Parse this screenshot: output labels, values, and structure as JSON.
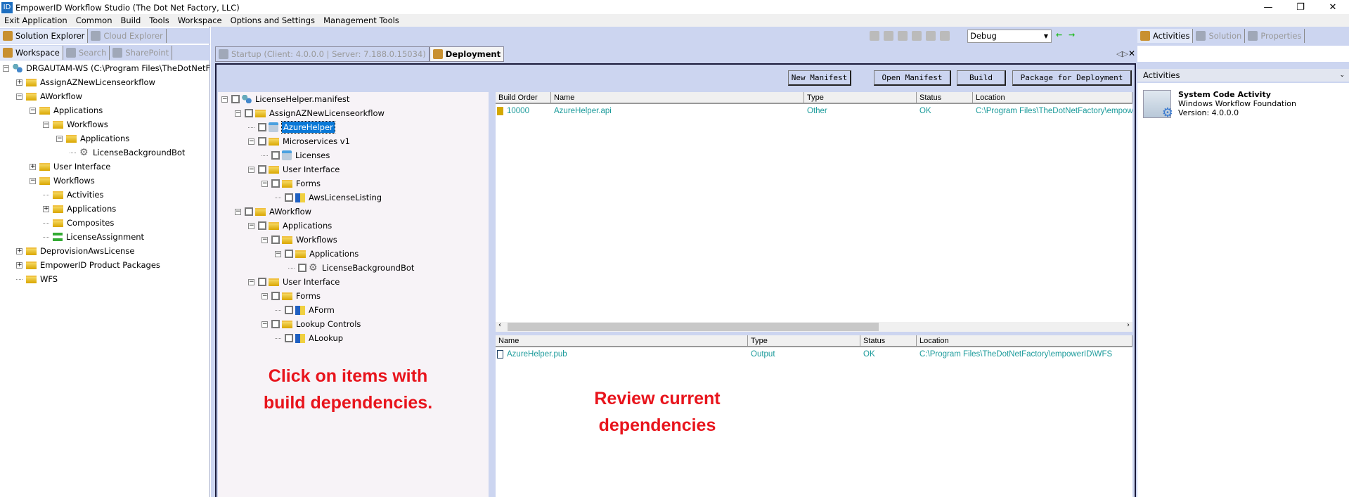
{
  "window": {
    "title": "EmpowerID Workflow Studio (The Dot Net Factory, LLC)",
    "logo": "ID",
    "controls": [
      "minimize",
      "restore",
      "close"
    ]
  },
  "menu": [
    "Exit Application",
    "Common",
    "Build",
    "Tools",
    "Workspace",
    "Options and Settings",
    "Management Tools"
  ],
  "left": {
    "top_tabs": [
      {
        "label": "Solution Explorer",
        "active": true
      },
      {
        "label": "Cloud Explorer",
        "active": false
      }
    ],
    "sub_tabs": [
      {
        "label": "Workspace",
        "active": true
      },
      {
        "label": "Search",
        "active": false
      },
      {
        "label": "SharePoint",
        "active": false
      }
    ],
    "tree": [
      {
        "label": "DRGAUTAM-WS (C:\\Program Files\\TheDotNetFactory\\empowerID\\WFS)",
        "level": 0,
        "exp": "minus",
        "icon": "network"
      },
      {
        "label": "AssignAZNewLicenseorkflow",
        "level": 1,
        "exp": "plus",
        "icon": "folder"
      },
      {
        "label": "AWorkflow",
        "level": 1,
        "exp": "minus",
        "icon": "folder"
      },
      {
        "label": "Applications",
        "level": 2,
        "exp": "minus",
        "icon": "folder"
      },
      {
        "label": "Workflows",
        "level": 3,
        "exp": "minus",
        "icon": "folder"
      },
      {
        "label": "Applications",
        "level": 4,
        "exp": "minus",
        "icon": "folder"
      },
      {
        "label": "LicenseBackgroundBot",
        "level": 5,
        "exp": null,
        "icon": "gear"
      },
      {
        "label": "User Interface",
        "level": 2,
        "exp": "plus",
        "icon": "folder"
      },
      {
        "label": "Workflows",
        "level": 2,
        "exp": "minus",
        "icon": "folder"
      },
      {
        "label": "Activities",
        "level": 3,
        "exp": null,
        "icon": "folder"
      },
      {
        "label": "Applications",
        "level": 3,
        "exp": "plus",
        "icon": "folder"
      },
      {
        "label": "Composites",
        "level": 3,
        "exp": null,
        "icon": "folder"
      },
      {
        "label": "LicenseAssignment",
        "level": 3,
        "exp": null,
        "icon": "workflow"
      },
      {
        "label": "DeprovisionAwsLicense",
        "level": 1,
        "exp": "plus",
        "icon": "folder"
      },
      {
        "label": "EmpowerID Product Packages",
        "level": 1,
        "exp": "plus",
        "icon": "folder"
      },
      {
        "label": "WFS",
        "level": 1,
        "exp": null,
        "icon": "folder"
      }
    ]
  },
  "toolbar": {
    "icons": [
      "save-icon",
      "check-icon",
      "play-icon",
      "stop-icon",
      "copy-icon",
      "windows-icon"
    ],
    "config": "Debug",
    "nav": [
      "back-arrow-icon",
      "forward-arrow-icon"
    ]
  },
  "doc_tabs": [
    {
      "label": "Startup (Client: 4.0.0.0 | Server: 7.188.0.15034)",
      "active": false
    },
    {
      "label": "Deployment",
      "active": true
    }
  ],
  "deployment": {
    "buttons": [
      "New Manifest",
      "Open Manifest",
      "Build",
      "Package for Deployment"
    ],
    "manifest_tree": [
      {
        "label": "LicenseHelper.manifest",
        "level": 0,
        "exp": "minus",
        "icon": "network"
      },
      {
        "label": "AssignAZNewLicenseorkflow",
        "level": 1,
        "exp": "minus",
        "icon": "folder"
      },
      {
        "label": "AzureHelper",
        "level": 2,
        "exp": null,
        "icon": "service",
        "selected": true
      },
      {
        "label": "Microservices v1",
        "level": 2,
        "exp": "minus",
        "icon": "folder"
      },
      {
        "label": "Licenses",
        "level": 3,
        "exp": null,
        "icon": "service"
      },
      {
        "label": "User Interface",
        "level": 2,
        "exp": "minus",
        "icon": "folder"
      },
      {
        "label": "Forms",
        "level": 3,
        "exp": "minus",
        "icon": "folder"
      },
      {
        "label": "AwsLicenseListing",
        "level": 4,
        "exp": null,
        "icon": "form"
      },
      {
        "label": "AWorkflow",
        "level": 1,
        "exp": "minus",
        "icon": "folder"
      },
      {
        "label": "Applications",
        "level": 2,
        "exp": "minus",
        "icon": "folder"
      },
      {
        "label": "Workflows",
        "level": 3,
        "exp": "minus",
        "icon": "folder"
      },
      {
        "label": "Applications",
        "level": 4,
        "exp": "minus",
        "icon": "folder"
      },
      {
        "label": "LicenseBackgroundBot",
        "level": 5,
        "exp": null,
        "icon": "gear"
      },
      {
        "label": "User Interface",
        "level": 2,
        "exp": "minus",
        "icon": "folder"
      },
      {
        "label": "Forms",
        "level": 3,
        "exp": "minus",
        "icon": "folder"
      },
      {
        "label": "AForm",
        "level": 4,
        "exp": null,
        "icon": "form"
      },
      {
        "label": "Lookup Controls",
        "level": 3,
        "exp": "minus",
        "icon": "folder"
      },
      {
        "label": "ALookup",
        "level": 4,
        "exp": null,
        "icon": "form"
      }
    ],
    "build_grid": {
      "headers": [
        "Build Order",
        "Name",
        "Type",
        "Status",
        "Location"
      ],
      "rows": [
        [
          "10000",
          "AzureHelper.api",
          "Other",
          "OK",
          "C:\\Program Files\\TheDotNetFactory\\empowerID\\WFS"
        ]
      ]
    },
    "output_grid": {
      "headers": [
        "Name",
        "Type",
        "Status",
        "Location"
      ],
      "rows": [
        [
          "AzureHelper.pub",
          "Output",
          "OK",
          "C:\\Program Files\\TheDotNetFactory\\empowerID\\WFS"
        ]
      ]
    }
  },
  "annotations": {
    "left": [
      "Click on items with",
      "build dependencies."
    ],
    "right": [
      "Review current",
      "dependencies"
    ],
    "color": "#e8141c"
  },
  "right": {
    "tabs": [
      {
        "label": "Activities",
        "active": true
      },
      {
        "label": "Solution",
        "active": false
      },
      {
        "label": "Properties",
        "active": false
      }
    ],
    "section": "Activities",
    "item": {
      "title": "System Code Activity",
      "subtitle": "Windows Workflow Foundation",
      "version": "Version:  4.0.0.0"
    }
  },
  "colors": {
    "panel_bg": "#ccd5f0",
    "grid_text": "#1a9a9a",
    "selection": "#0a78d7"
  }
}
